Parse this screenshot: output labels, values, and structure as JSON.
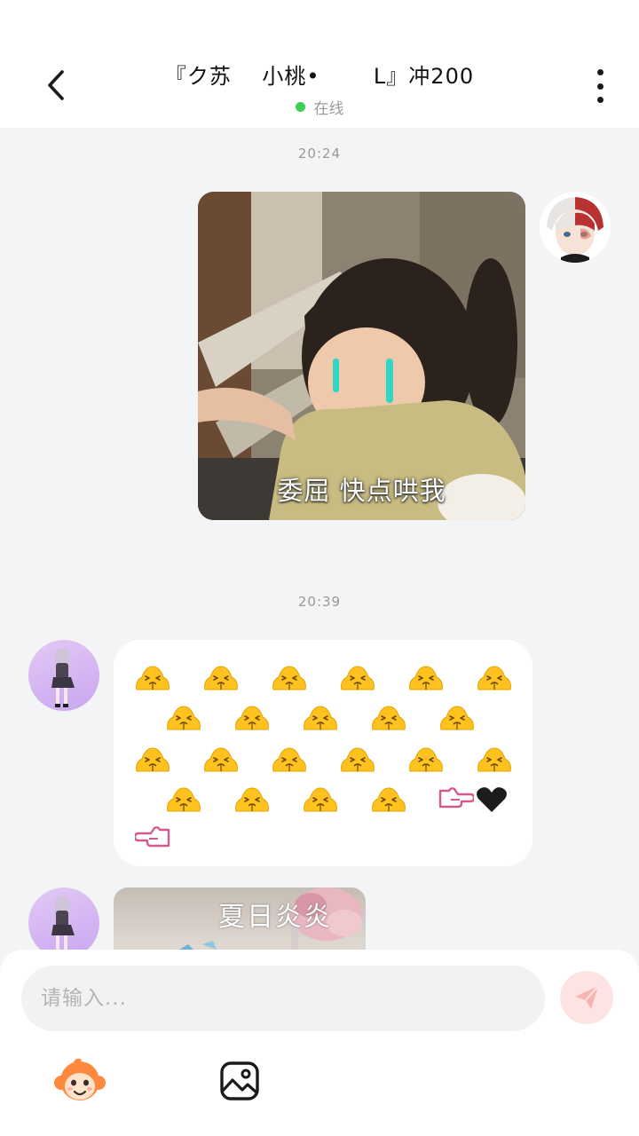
{
  "header": {
    "title": "『ク苏    小桃•       L』冲200",
    "status": "在线",
    "status_color": "#3ccf53"
  },
  "messages": [
    {
      "time": "20:24"
    },
    {
      "sender": "self",
      "type": "image",
      "caption": "委屈 快点哄我"
    },
    {
      "time": "20:39"
    },
    {
      "sender": "other",
      "type": "emoji",
      "emoji_count": 21,
      "hand_icons": [
        "point-right-icon",
        "heart-icon",
        "point-left-icon"
      ]
    },
    {
      "sender": "other",
      "type": "image",
      "overlay_text": "夏日炎炎"
    }
  ],
  "composer": {
    "placeholder": "请输入...",
    "send_color": "#fde3e2"
  },
  "icons": {
    "back": "chevron-left-icon",
    "more": "more-vertical-icon",
    "send": "send-icon",
    "sticker": "monkey-sticker-icon",
    "image": "image-icon"
  }
}
